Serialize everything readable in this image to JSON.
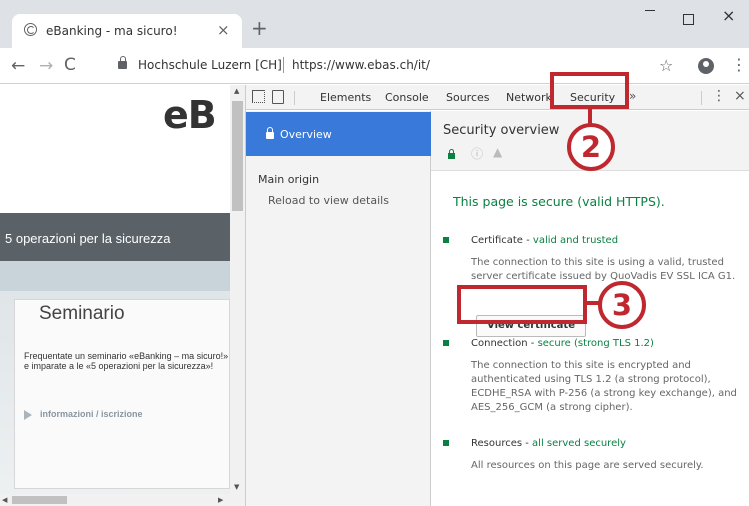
{
  "browser": {
    "tab_title": "eBanking - ma sicuro!",
    "tab_close": "×",
    "new_tab": "+",
    "site_name": "Hochschule Luzern [CH]",
    "url": "https://www.ebas.ch/it/",
    "win_close": "×",
    "nav_back": "←",
    "nav_forward": "→",
    "nav_reload": "C",
    "star": "☆",
    "menu": "⋮"
  },
  "page": {
    "logo": "eB",
    "band_text": "5 operazioni per la sicurezza",
    "seminar_title": "Seminario",
    "seminar_text": "Frequentate un seminario «eBanking – ma sicuro!» e imparate a le «5 operazioni per la sicurezza»!",
    "seminar_link": "informazioni / iscrizione"
  },
  "devtools": {
    "tabs": [
      "Elements",
      "Console",
      "Sources",
      "Network",
      "Security"
    ],
    "active_tab": "Security",
    "more": "»",
    "kebab": "⋮",
    "close": "×",
    "sidebar": {
      "overview": "Overview",
      "main_origin": "Main origin",
      "reload_hint": "Reload to view details"
    },
    "security": {
      "title": "Security overview",
      "info_icon": "ⓘ",
      "warn_icon": "▲",
      "secure_headline": "This page is secure (valid HTTPS).",
      "certificate_label": "Certificate - ",
      "certificate_status": "valid and trusted",
      "certificate_desc": "The connection to this site is using a valid, trusted server certificate issued by QuoVadis EV SSL ICA G1.",
      "view_certificate": "View certificate",
      "connection_label": "Connection - ",
      "connection_status": "secure (strong TLS 1.2)",
      "connection_desc": "The connection to this site is encrypted and authenticated using TLS 1.2 (a strong protocol), ECDHE_RSA with P-256 (a strong key exchange), and AES_256_GCM (a strong cipher).",
      "resources_label": "Resources - ",
      "resources_status": "all served securely",
      "resources_desc": "All resources on this page are served securely."
    }
  },
  "annotations": {
    "step_2": "2",
    "step_3": "3",
    "color": "#c0282f"
  }
}
